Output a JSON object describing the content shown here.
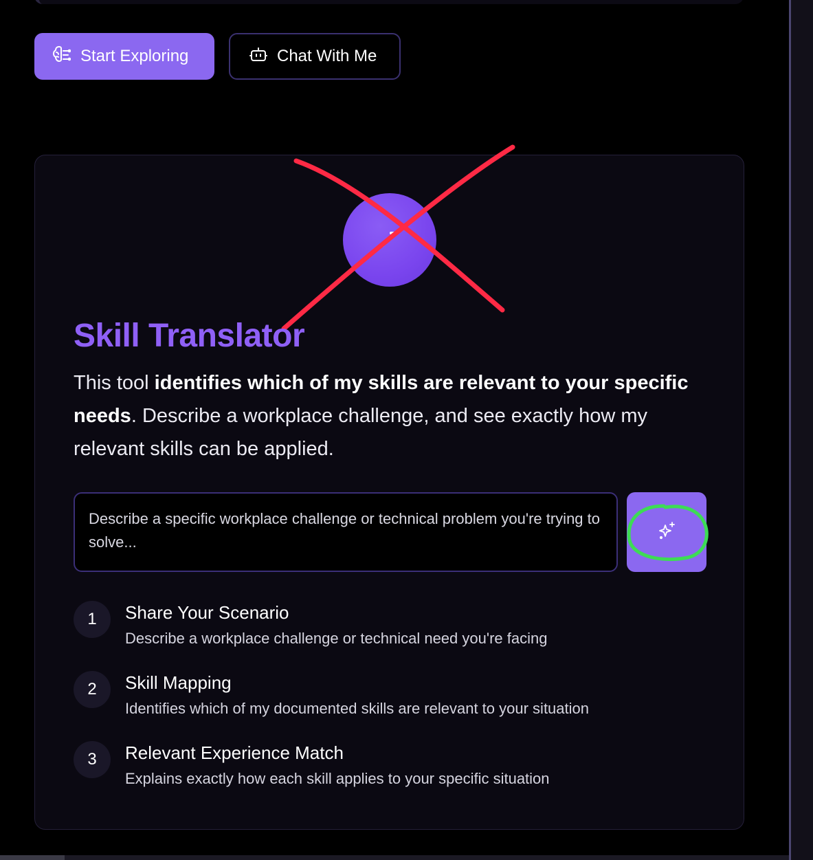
{
  "buttons": {
    "start_exploring": "Start Exploring",
    "chat_with_me": "Chat With Me"
  },
  "card": {
    "title": "Skill Translator",
    "description": {
      "part1": "This tool ",
      "bold1": "identifies which of my skills are relevant to your specific needs",
      "part2": ". Describe a workplace challenge, and see exactly how my relevant skills can be applied."
    },
    "input": {
      "placeholder": "Describe a specific workplace challenge or technical problem you're trying to solve..."
    },
    "steps": [
      {
        "number": "1",
        "title": "Share Your Scenario",
        "subtitle": "Describe a workplace challenge or technical need you're facing"
      },
      {
        "number": "2",
        "title": "Skill Mapping",
        "subtitle": "Identifies which of my documented skills are relevant to your situation"
      },
      {
        "number": "3",
        "title": "Relevant Experience Match",
        "subtitle": "Explains exactly how each skill applies to your specific situation"
      }
    ]
  },
  "icons": {
    "start_exploring": "brain-icon",
    "chat_with_me": "bot-icon",
    "hero": "arrow-icon",
    "submit": "sparkles-icon"
  },
  "annotations": {
    "red_x_color": "#ff2a45",
    "green_circle_color": "#3ddc55"
  },
  "colors": {
    "accent": "#8b68f0",
    "title": "#8f60f6",
    "background": "#000000"
  }
}
